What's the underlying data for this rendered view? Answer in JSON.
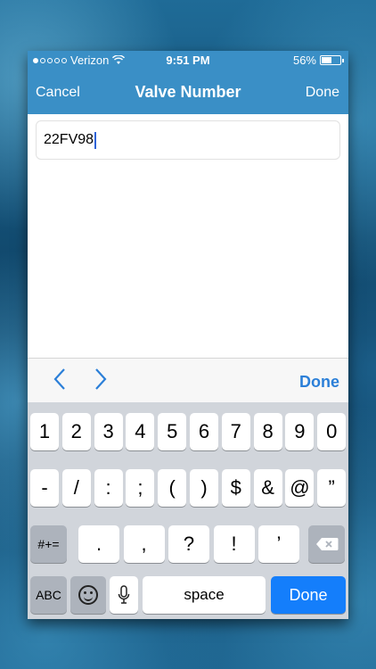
{
  "status_bar": {
    "carrier": "Verizon",
    "time": "9:51 PM",
    "battery_text": "56%",
    "battery_level": 0.56,
    "signal_dots_filled": 1
  },
  "nav": {
    "cancel": "Cancel",
    "title": "Valve Number",
    "done": "Done"
  },
  "field": {
    "value": "22FV98"
  },
  "accessory": {
    "prev_icon": "chevron-left-icon",
    "next_icon": "chevron-right-icon",
    "done": "Done"
  },
  "keyboard": {
    "row1": [
      "1",
      "2",
      "3",
      "4",
      "5",
      "6",
      "7",
      "8",
      "9",
      "0"
    ],
    "row2": [
      "-",
      "/",
      ":",
      ";",
      "(",
      ")",
      "$",
      "&",
      "@",
      "”"
    ],
    "row3": [
      ".",
      ",",
      "?",
      "!",
      "’"
    ],
    "shift_label": "#+=",
    "abc_label": "ABC",
    "space_label": "space",
    "done_label": "Done"
  },
  "colors": {
    "nav_bg": "#3a8fc6",
    "accent": "#2b7fd8",
    "done_key": "#147efb"
  }
}
